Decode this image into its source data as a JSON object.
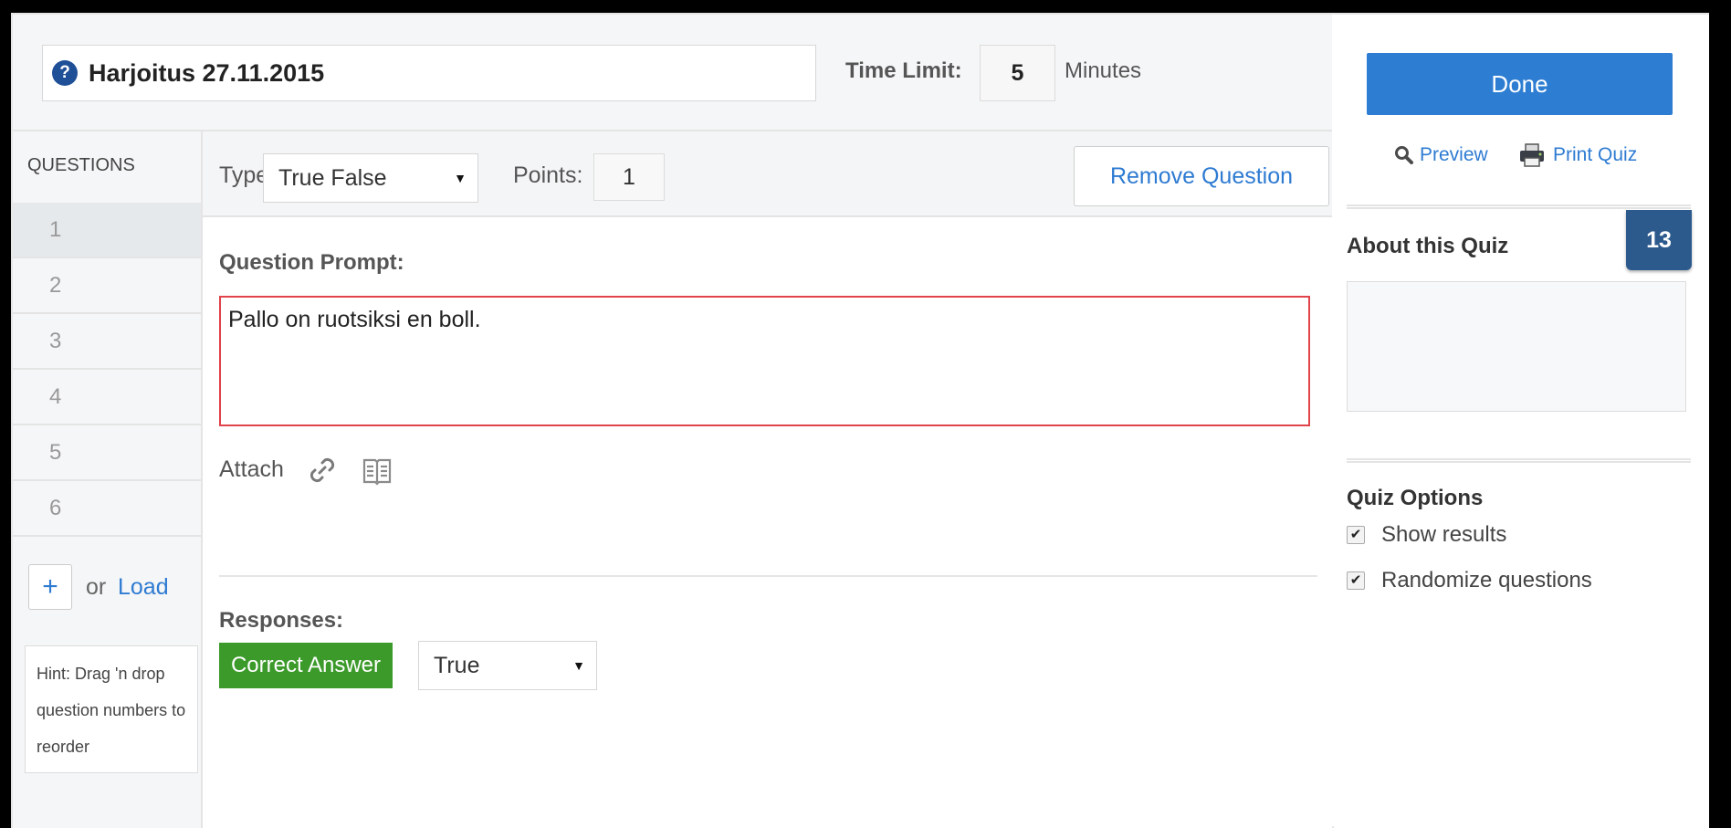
{
  "header": {
    "quiz_title": "Harjoitus 27.11.2015",
    "title_icon": "question-icon",
    "time_limit_label": "Time Limit:",
    "time_limit_value": "5",
    "time_limit_unit": "Minutes"
  },
  "sidebar": {
    "questions_label": "QUESTIONS",
    "question_numbers": [
      "1",
      "2",
      "3",
      "4",
      "5",
      "6"
    ],
    "active_question": "1",
    "add_symbol": "+",
    "or_text": "or",
    "load_label": "Load",
    "hint_text": "Hint: Drag 'n drop question numbers to reorder"
  },
  "editor": {
    "type_label": "Type",
    "type_value": "True False",
    "points_label": "Points:",
    "points_value": "1",
    "remove_label": "Remove Question",
    "prompt_label": "Question Prompt:",
    "prompt_text": "Pallo on ruotsiksi en boll.",
    "attach_label": "Attach",
    "attach_icons": [
      "link-icon",
      "book-icon"
    ],
    "responses_label": "Responses:",
    "correct_label": "Correct Answer",
    "correct_value": "True"
  },
  "right_panel": {
    "done_label": "Done",
    "preview_label": "Preview",
    "print_label": "Print Quiz",
    "about_label": "About this Quiz",
    "badge_count": "13",
    "options_label": "Quiz Options",
    "options": [
      {
        "label": "Show results",
        "checked": true
      },
      {
        "label": "Randomize questions",
        "checked": true
      }
    ]
  },
  "colors": {
    "accent_blue": "#2d7dd2",
    "correct_green": "#3c9a2b",
    "error_red": "#e0434a",
    "badge_navy": "#2c5a8c"
  }
}
